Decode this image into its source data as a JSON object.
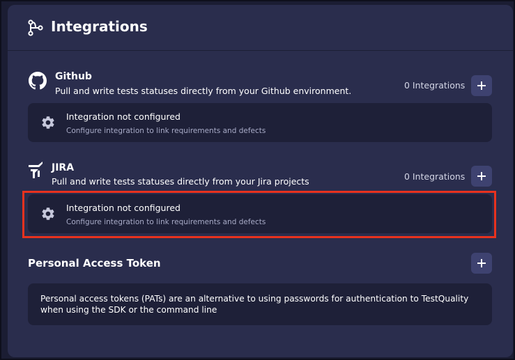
{
  "page": {
    "title": "Integrations",
    "title_icon": "integrations-branch-icon"
  },
  "github": {
    "icon": "github-icon",
    "title": "Github",
    "description": "Pull and write tests statuses directly from your Github environment.",
    "count_label": "0 Integrations",
    "add_label": "+",
    "card": {
      "icon": "gear-icon",
      "title": "Integration not configured",
      "subtitle": "Configure integration to link requirements and defects"
    }
  },
  "jira": {
    "icon": "jira-icon",
    "title": "JIRA",
    "description": "Pull and write tests statuses directly from your Jira projects",
    "count_label": "0 Integrations",
    "add_label": "+",
    "card": {
      "icon": "gear-icon",
      "title": "Integration not configured",
      "subtitle": "Configure integration to link requirements and defects"
    },
    "highlight_color": "#e8321e"
  },
  "pat": {
    "title": "Personal Access Token",
    "add_label": "+",
    "description": "Personal access tokens (PATs) are an alternative to using passwords for authentication to TestQuality when using the SDK or the command line"
  },
  "colors": {
    "background": "#1b1d33",
    "panel": "#2a2d4d",
    "card": "#1e2038",
    "button": "#3e4270",
    "highlight": "#e8321e"
  }
}
